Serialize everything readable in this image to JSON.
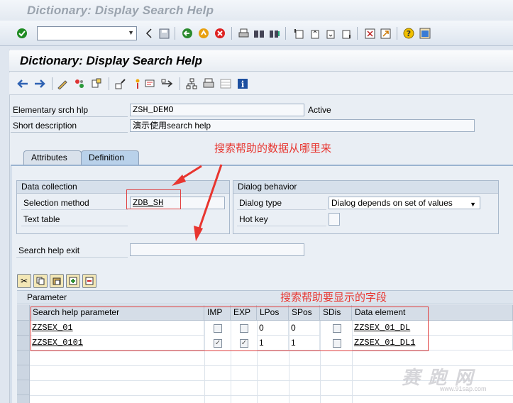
{
  "window": {
    "title": "Dictionary: Display Search Help"
  },
  "toolbar": {
    "command_field_value": ""
  },
  "screen": {
    "title": "Dictionary: Display Search Help"
  },
  "header": {
    "elementary_label": "Elementary srch hlp",
    "elementary_value": "ZSH_DEMO",
    "status": "Active",
    "short_desc_label": "Short description",
    "short_desc_value": "演示使用search help"
  },
  "tabs": [
    {
      "label": "Attributes"
    },
    {
      "label": "Definition"
    }
  ],
  "data_collection": {
    "title": "Data collection",
    "selection_method_label": "Selection method",
    "selection_method_value": "ZDB_SH",
    "text_table_label": "Text table",
    "text_table_value": ""
  },
  "dialog_behavior": {
    "title": "Dialog behavior",
    "dialog_type_label": "Dialog type",
    "dialog_type_value": "Dialog depends on set of values",
    "hot_key_label": "Hot key",
    "hot_key_value": ""
  },
  "search_help_exit": {
    "label": "Search help exit",
    "value": ""
  },
  "parameter": {
    "title": "Parameter",
    "columns": [
      "Search help parameter",
      "IMP",
      "EXP",
      "LPos",
      "SPos",
      "SDis",
      "Data element"
    ],
    "rows": [
      {
        "param": "ZZSEX_01",
        "imp": false,
        "exp": false,
        "lpos": "0",
        "spos": "0",
        "sdis": false,
        "data_element": "ZZSEX_01_DL"
      },
      {
        "param": "ZZSEX_0101",
        "imp": true,
        "exp": true,
        "lpos": "1",
        "spos": "1",
        "sdis": false,
        "data_element": "ZZSEX_01_DL1"
      }
    ]
  },
  "annotations": {
    "note_data_source": "搜索帮助的数据从哪里来",
    "note_fields": "搜索帮助要显示的字段"
  },
  "watermark": {
    "text": "赛 跑 网",
    "url": "www.91sap.com"
  },
  "colors": {
    "annotation_red": "#e8352f",
    "tab_active": "#b9d1ea"
  }
}
